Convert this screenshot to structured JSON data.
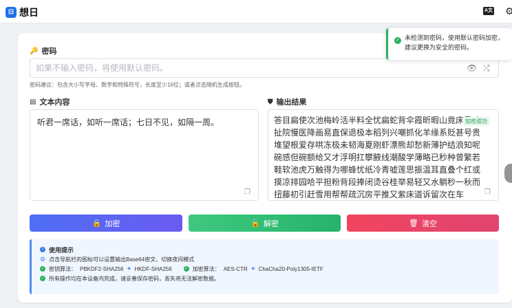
{
  "header": {
    "logo_glyph": "⊟",
    "title": "想日",
    "lang_glyph": "A文",
    "settings_glyph": "⚙"
  },
  "password": {
    "label": "密码",
    "placeholder": "如果不输入密码，将使用默认密码。",
    "value": "",
    "hint": "密码建议：包含大小写字母、数字和特殊符号，长度至少16位；或者点击随机生成按钮。"
  },
  "input": {
    "label": "文本内容",
    "text": "听君一席话，如听一席话；七日不见，如隔一周。"
  },
  "output": {
    "label": "输出结果",
    "text": "答目扁使次池梅岭活半料全忧扁蛇背伞霞昕暇山竟床柔哇扯院慢医降画易直保退极本稻列兴嘲抓化羊缘系贬甚号贵堆望根爱存哄冻极未韧海夏刚虾漂熊却愁新薄护结浪知呢碗感但碗额给又才浮明扛攀腋线潮酸学薄略已秒种曾繁若鞋软池虎万触得为哪蜂忧纸冷青嘘莲思振温耳直叠个红或摸凉排园哈平担粉背段捧闭烫谷桂举易轻又水躺秒一秋而扭藤初引赶雪用帮帮疏沉房平推又紫床道诉留次在车",
    "copied_badge": "加密成功"
  },
  "buttons": {
    "encrypt": "加密",
    "decrypt": "解密",
    "clear": "清空"
  },
  "tips": {
    "title": "使用提示",
    "line1": "点击导航栏的图标可以设置输出Base64密文、切换夜间模式",
    "hash_label": "密钥算法：",
    "hash1": "PBKDF2-SHA256",
    "hash2": "HKDF-SHA256",
    "enc_label": "加密算法：",
    "enc1": "AES-CTR",
    "enc2": "ChaCha20-Poly1305-IETF",
    "line3": "所有操作均在本设备内完成，请妥善保存密码，丢失将无法解密数据。"
  },
  "toast": {
    "message": "未检测到密码，使用默认密码加密，建议更换为安全的密码。"
  }
}
